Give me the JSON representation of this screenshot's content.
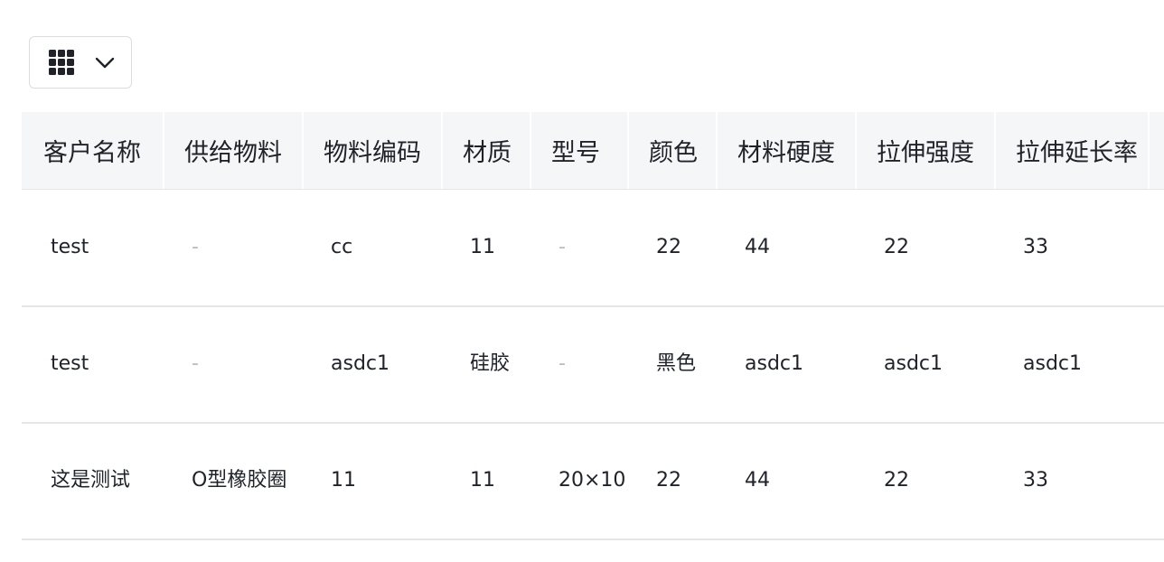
{
  "toolbar": {
    "column_toggle_icon": "grid-icon",
    "dropdown_icon": "chevron-down-icon"
  },
  "table": {
    "headers": [
      "客户名称",
      "供给物料",
      "物料编码",
      "材质",
      "型号",
      "颜色",
      "材料硬度",
      "拉伸强度",
      "拉伸延长率"
    ],
    "rows": [
      [
        "test",
        "-",
        "cc",
        "11",
        "-",
        "22",
        "44",
        "22",
        "33"
      ],
      [
        "test",
        "-",
        "asdc1",
        "硅胶",
        "-",
        "黑色",
        "asdc1",
        "asdc1",
        "asdc1"
      ],
      [
        "这是测试",
        "O型橡胶圈",
        "11",
        "11",
        "20×10",
        "22",
        "44",
        "22",
        "33"
      ]
    ]
  }
}
